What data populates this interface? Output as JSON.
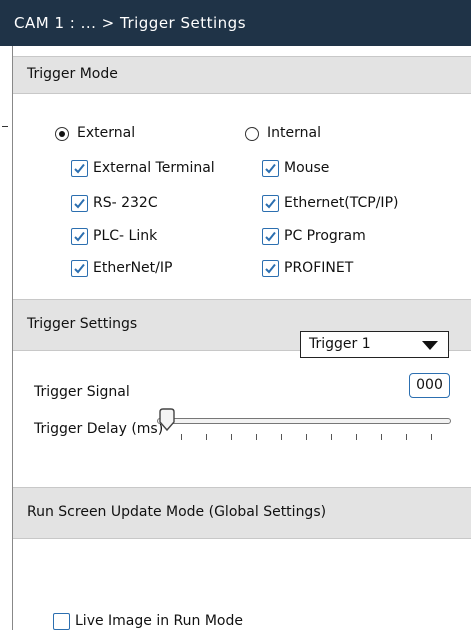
{
  "header": {
    "title": "CAM 1 : ... > Trigger Settings"
  },
  "trigger_mode": {
    "heading": "Trigger Mode",
    "radios": [
      {
        "label": "External",
        "selected": true
      },
      {
        "label": "Internal",
        "selected": false
      }
    ],
    "checkboxes": [
      {
        "label": "External Terminal",
        "checked": true
      },
      {
        "label": "Mouse",
        "checked": true
      },
      {
        "label": "RS- 232C",
        "checked": true
      },
      {
        "label": "Ethernet(TCP/IP)",
        "checked": true
      },
      {
        "label": "PLC- Link",
        "checked": true
      },
      {
        "label": "PC Program",
        "checked": true
      },
      {
        "label": "EtherNet/IP",
        "checked": true
      },
      {
        "label": "PROFINET",
        "checked": true
      }
    ]
  },
  "trigger_settings": {
    "heading": "Trigger Settings",
    "signal_label": "Trigger Signal",
    "signal_value": "Trigger 1",
    "delay_label": "Trigger Delay (ms)",
    "delay_value": "000",
    "delay_slider_fraction": 0
  },
  "run_screen": {
    "heading": "Run Screen Update Mode (Global Settings)",
    "live_image_label": "Live Image in Run Mode",
    "live_image_checked": false
  },
  "colors": {
    "titlebar": "#1f3347",
    "section_header": "#e3e3e3",
    "checkbox_accent": "#2c6fb0"
  }
}
